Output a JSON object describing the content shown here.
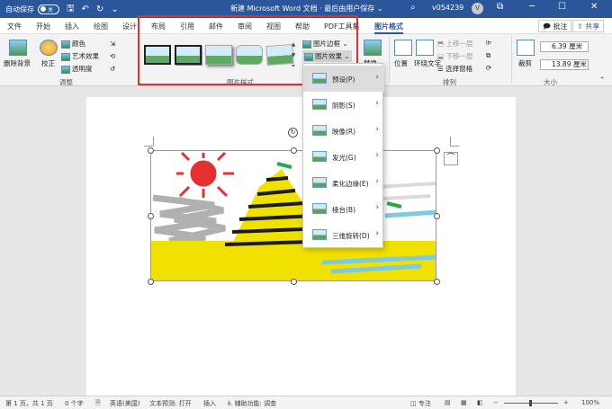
{
  "titlebar": {
    "autosave_label": "自动保存",
    "autosave_state": "关",
    "doc_title": "新建 Microsoft Word 文档 · 最后由用户保存 ⌄",
    "user_name": "v054239",
    "avatar_letter": "V",
    "save_icon": "save-icon",
    "undo_icon": "undo-icon",
    "redo_icon": "redo-icon"
  },
  "tabs": {
    "file": "文件",
    "home": "开始",
    "insert": "插入",
    "draw": "绘图",
    "design": "设计",
    "layout": "布局",
    "references": "引用",
    "mailings": "邮件",
    "review": "审阅",
    "view": "视图",
    "help": "帮助",
    "pdf": "PDF工具集",
    "picture_format": "图片格式",
    "comments": "批注",
    "share": "共享"
  },
  "ribbon": {
    "remove_bg": "删除背景",
    "corrections": "校正",
    "color": "颜色",
    "artistic": "艺术效果",
    "transparency": "透明度",
    "adjust_label": "调整",
    "styles_label": "图片样式",
    "border": "图片边框",
    "effects": "图片效果",
    "alt_text": "替换",
    "position": "位置",
    "wrap_text": "环绕文字",
    "bring_forward": "上移一层",
    "send_backward": "下移一层",
    "selection_pane": "选择窗格",
    "arrange_label": "排列",
    "crop": "裁剪",
    "height": "6.39 厘米",
    "width": "13.89 厘米",
    "size_label": "大小"
  },
  "effects_menu": [
    {
      "label": "预设(P)"
    },
    {
      "label": "阴影(S)"
    },
    {
      "label": "映像(R)"
    },
    {
      "label": "发光(G)"
    },
    {
      "label": "柔化边缘(E)"
    },
    {
      "label": "棱台(B)"
    },
    {
      "label": "三维旋转(D)"
    }
  ],
  "statusbar": {
    "page": "第 1 页，共 1 页",
    "words": "0 个字",
    "language": "英语(美国)",
    "text_prediction": "文本预测: 打开",
    "insert": "插入",
    "accessibility": "辅助功能: 调查",
    "focus": "专注",
    "zoom": "100%"
  },
  "colors": {
    "title_bar": "#2b579a",
    "highlight_box": "#e03030",
    "accent": "#2b579a"
  }
}
